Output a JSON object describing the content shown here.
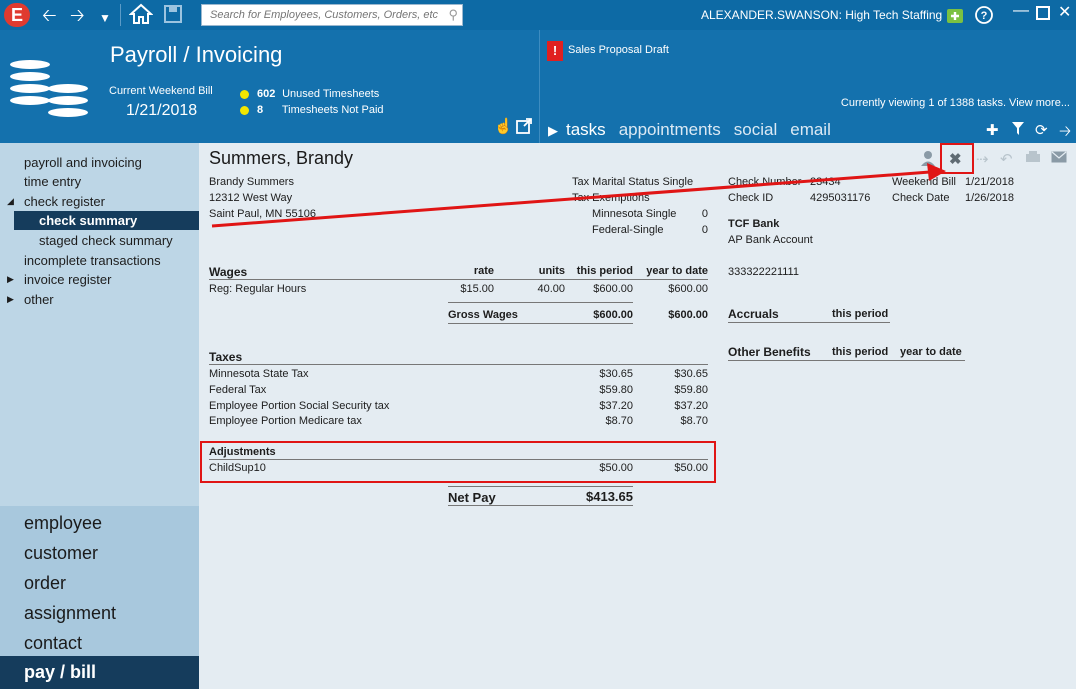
{
  "topbar": {
    "search_placeholder": "Search for Employees, Customers, Orders, etc.",
    "user_label": "ALEXANDER.SWANSON: High Tech Staffing",
    "icons": [
      "e-logo-icon",
      "back-arrow-icon",
      "forward-arrow-icon",
      "dropdown-icon",
      "home-icon",
      "save-icon",
      "search-icon",
      "add-medical-icon",
      "help-icon",
      "minimize-icon",
      "maximize-icon",
      "close-icon"
    ]
  },
  "header": {
    "title": "Payroll / Invoicing",
    "current_weekend_label": "Current Weekend Bill",
    "current_weekend_date": "1/21/2018",
    "stats": [
      {
        "count": "602",
        "label": "Unused Timesheets"
      },
      {
        "count": "8",
        "label": "Timesheets Not Paid"
      }
    ],
    "alert_badge": "!",
    "alert_text": "Sales  Proposal Draft",
    "viewing_text": "Currently viewing 1 of 1388 tasks. View more...",
    "tabs": [
      "tasks",
      "appointments",
      "social",
      "email"
    ]
  },
  "sidebar": {
    "nav": [
      {
        "label": "payroll and invoicing"
      },
      {
        "label": "time entry"
      },
      {
        "label": "check register"
      },
      {
        "label": "check summary"
      },
      {
        "label": "staged check summary"
      },
      {
        "label": "incomplete transactions"
      },
      {
        "label": "invoice register"
      },
      {
        "label": "other"
      }
    ],
    "big_nav": [
      "employee",
      "customer",
      "order",
      "assignment",
      "contact",
      "pay / bill"
    ]
  },
  "check": {
    "employee_name": "Summers, Brandy",
    "address_lines": [
      "Brandy  Summers",
      "12312 West Way",
      "Saint Paul, MN  55106"
    ],
    "tax_marital_label": "Tax Marital Status",
    "tax_marital_value": "Single",
    "tax_exemptions_label": "Tax Exemptions",
    "exemptions": [
      {
        "label": "Minnesota Single",
        "value": "0"
      },
      {
        "label": "Federal-Single",
        "value": "0"
      }
    ],
    "check_number_label": "Check Number",
    "check_number_value": "23434",
    "check_id_label": "Check ID",
    "check_id_value": "4295031176",
    "weekend_bill_label": "Weekend Bill",
    "weekend_bill_value": "1/21/2018",
    "check_date_label": "Check Date",
    "check_date_value": "1/26/2018",
    "bank_name": "TCF Bank",
    "bank_account_label": "AP Bank Account",
    "bank_account_number": "333322221111",
    "wages": {
      "header": "Wages",
      "columns": [
        "rate",
        "units",
        "this period",
        "year to date"
      ],
      "rows": [
        {
          "label": "Reg: Regular Hours",
          "rate": "$15.00",
          "units": "40.00",
          "this_period": "$600.00",
          "ytd": "$600.00"
        }
      ],
      "gross_label": "Gross Wages",
      "gross_this_period": "$600.00",
      "gross_ytd": "$600.00"
    },
    "taxes": {
      "header": "Taxes",
      "rows": [
        {
          "label": "Minnesota State Tax",
          "this_period": "$30.65",
          "ytd": "$30.65"
        },
        {
          "label": "Federal Tax",
          "this_period": "$59.80",
          "ytd": "$59.80"
        },
        {
          "label": "Employee Portion Social Security tax",
          "this_period": "$37.20",
          "ytd": "$37.20"
        },
        {
          "label": "Employee Portion  Medicare tax",
          "this_period": "$8.70",
          "ytd": "$8.70"
        }
      ]
    },
    "adjustments": {
      "header": "Adjustments",
      "rows": [
        {
          "label": "ChildSup10",
          "this_period": "$50.00",
          "ytd": "$50.00"
        }
      ]
    },
    "net_pay_label": "Net Pay",
    "net_pay_value": "$413.65",
    "accruals_label": "Accruals",
    "accruals_col": "this period",
    "other_benefits_label": "Other Benefits",
    "other_benefits_cols": [
      "this period",
      "year to date"
    ]
  },
  "colors": {
    "topbar": "#0d6aa5",
    "header": "#1471ad",
    "sidebar": "#bdd6e6",
    "sidebar_active": "#153c5c",
    "highlight_red": "#e01515"
  }
}
